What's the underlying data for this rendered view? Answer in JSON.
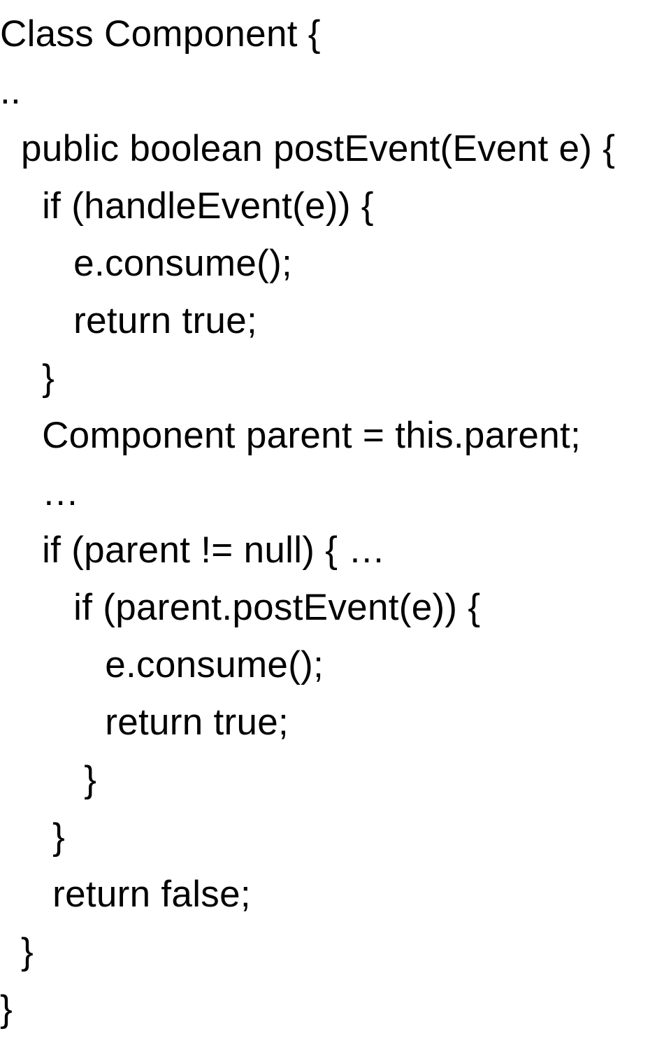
{
  "code": {
    "lines": [
      "Class Component {",
      "..",
      "  public boolean postEvent(Event e) {",
      "    if (handleEvent(e)) {",
      "       e.consume();",
      "       return true;",
      "    }",
      "    Component parent = this.parent;",
      "    …",
      "    if (parent != null) { …",
      "       if (parent.postEvent(e)) {",
      "          e.consume();",
      "          return true;",
      "        }",
      "     }",
      "     return false;",
      "  }",
      "}"
    ]
  }
}
